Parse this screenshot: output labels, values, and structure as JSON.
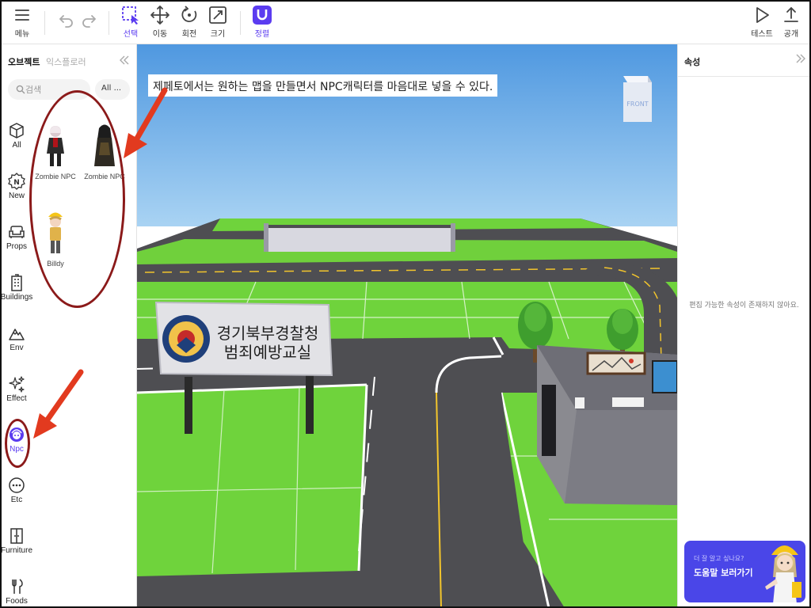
{
  "toolbar": {
    "menu": "메뉴",
    "select": "선택",
    "move": "이동",
    "rotate": "회전",
    "scale": "크기",
    "align": "정렬",
    "test": "테스트",
    "publish": "공개"
  },
  "left_panel": {
    "tabs": [
      "오브젝트",
      "익스플로러"
    ],
    "search_placeholder": "검색",
    "filter_value": "All ...",
    "categories": [
      "All",
      "New",
      "Props",
      "Buildings",
      "Env",
      "Effect",
      "Npc",
      "Etc",
      "Furniture",
      "Foods"
    ],
    "active_category": "Npc",
    "items": [
      "Zombie NPC",
      "Zombie NPC",
      "Billdy"
    ]
  },
  "viewport": {
    "caption": "제페토에서는 원하는 맵을 만들면서 NPC캐릭터를 마음대로 넣을 수 있다.",
    "cube_face": "FRONT",
    "sign_line1": "경기북부경찰청",
    "sign_line2": "범죄예방교실"
  },
  "right_panel": {
    "title": "속성",
    "empty_message": "편집 가능한 속성이 존재하지 않아요.",
    "help_sub": "더 잘 알고 싶나요?",
    "help_main": "도움말 보러가기"
  },
  "colors": {
    "accent": "#5b3cf0",
    "sky": "#5fa6e3",
    "grass": "#6fd33c",
    "road": "#4e4e52",
    "annotation": "#8b1a1a",
    "arrow": "#e23a1f",
    "help_banner": "#4a46e8"
  }
}
